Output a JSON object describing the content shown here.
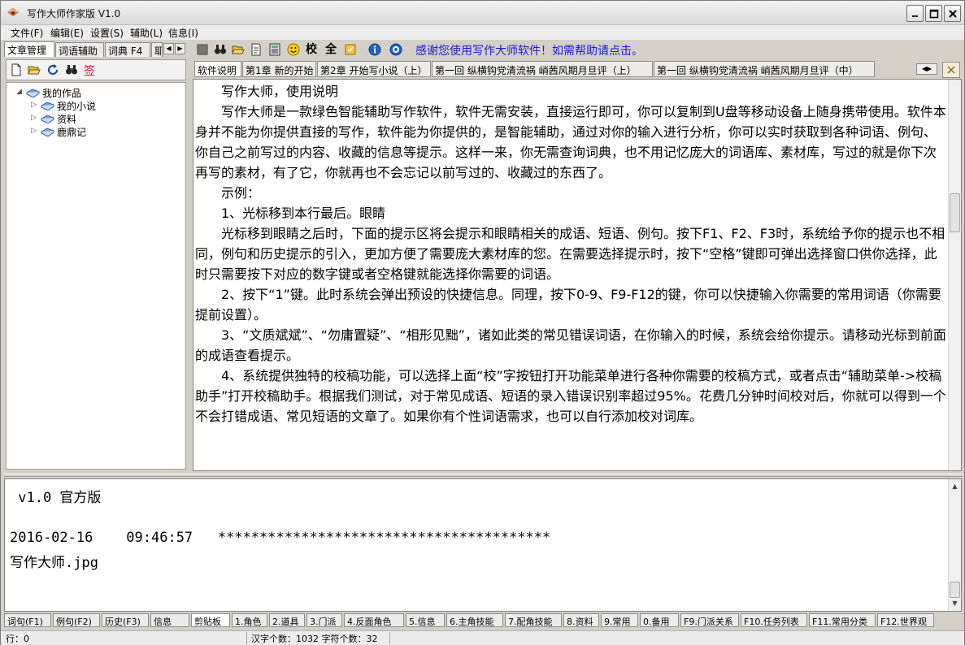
{
  "window": {
    "title": "写作大师作家版  V1.0"
  },
  "menu": [
    {
      "label": "文件(F)"
    },
    {
      "label": "编辑(E)"
    },
    {
      "label": "设置(S)"
    },
    {
      "label": "辅助(L)"
    },
    {
      "label": "信息(I)"
    }
  ],
  "left_tabs": [
    {
      "label": "文章管理"
    },
    {
      "label": "词语辅助"
    },
    {
      "label": "词典  F4"
    },
    {
      "label": "耶"
    }
  ],
  "tree": {
    "root": "我的作品",
    "children": [
      {
        "label": "我的小说"
      },
      {
        "label": "资料"
      },
      {
        "label": "鹿鼎记"
      }
    ]
  },
  "toolbar": {
    "proof_label": "校",
    "all_label": "全",
    "help_link": "感谢您使用写作大师软件！如需帮助请点击。"
  },
  "doc_tabs": [
    {
      "label": "软件说明"
    },
    {
      "label": "第1章 新的开始"
    },
    {
      "label": "第2章 开始写小说（上）"
    },
    {
      "label": "第一回  纵横钩党清流祸  峭茜风期月旦评（上）"
    },
    {
      "label": "第一回  纵横钩党清流祸  峭茜风期月旦评（中）"
    }
  ],
  "editor": {
    "paragraphs": [
      "写作大师，使用说明",
      "写作大师是一款绿色智能辅助写作软件，软件无需安装，直接运行即可，你可以复制到U盘等移动设备上随身携带使用。软件本身并不能为你提供直接的写作，软件能为你提供的，是智能辅助，通过对你的输入进行分析，你可以实时获取到各种词语、例句、你自己之前写过的内容、收藏的信息等提示。这样一来，你无需查询词典，也不用记忆庞大的词语库、素材库，写过的就是你下次再写的素材，有了它，你就再也不会忘记以前写过的、收藏过的东西了。",
      "示例：",
      "1、光标移到本行最后。眼睛",
      "光标移到眼睛之后时，下面的提示区将会提示和眼睛相关的成语、短语、例句。按下F1、F2、F3时，系统给予你的提示也不相同，例句和历史提示的引入，更加方便了需要庞大素材库的您。在需要选择提示时，按下“空格”键即可弹出选择窗口供你选择，此时只需要按下对应的数字键或者空格键就能选择你需要的词语。",
      "2、按下“1”键。此时系统会弹出预设的快捷信息。同理，按下0-9、F9-F12的键，你可以快捷输入你需要的常用词语（你需要提前设置）。",
      "3、“文质斌斌”、“勿庸置疑”、“相形见黜”，诸如此类的常见错误词语，在你输入的时候，系统会给你提示。请移动光标到前面的成语查看提示。",
      "4、系统提供独特的校稿功能，可以选择上面“校”字按钮打开功能菜单进行各种你需要的校稿方式，或者点击“辅助菜单->校稿助手”打开校稿助手。根据我们测试，对于常见成语、短语的录入错误识别率超过95%。花费几分钟时间校对后，你就可以得到一个不会打错成语、常见短语的文章了。如果你有个性词语需求，也可以自行添加校对词库。"
    ]
  },
  "hint": {
    "lines": [
      " v1.0 官方版",
      "",
      "2016-02-16    09:46:57   ****************************************",
      "写作大师.jpg"
    ]
  },
  "bottom_tabs": [
    {
      "label": "词句(F1)"
    },
    {
      "label": "例句(F2)"
    },
    {
      "label": "历史(F3)"
    },
    {
      "label": "信息"
    },
    {
      "label": "剪贴板"
    },
    {
      "label": "1.角色"
    },
    {
      "label": "2.道具"
    },
    {
      "label": "3.门派"
    },
    {
      "label": "4.反面角色"
    },
    {
      "label": "5.信息"
    },
    {
      "label": "6.主角技能"
    },
    {
      "label": "7.配角技能"
    },
    {
      "label": "8.资料"
    },
    {
      "label": "9.常用"
    },
    {
      "label": "0.备用"
    },
    {
      "label": "F9.门派关系"
    },
    {
      "label": "F10.任务列表"
    },
    {
      "label": "F11.常用分类"
    },
    {
      "label": "F12.世界观"
    }
  ],
  "status": {
    "row": "行：0",
    "counts": "汉字个数：1032  字符个数：32"
  },
  "colors": {
    "link": "#1a1ad8",
    "panel_bg": "#d4d0c8"
  }
}
